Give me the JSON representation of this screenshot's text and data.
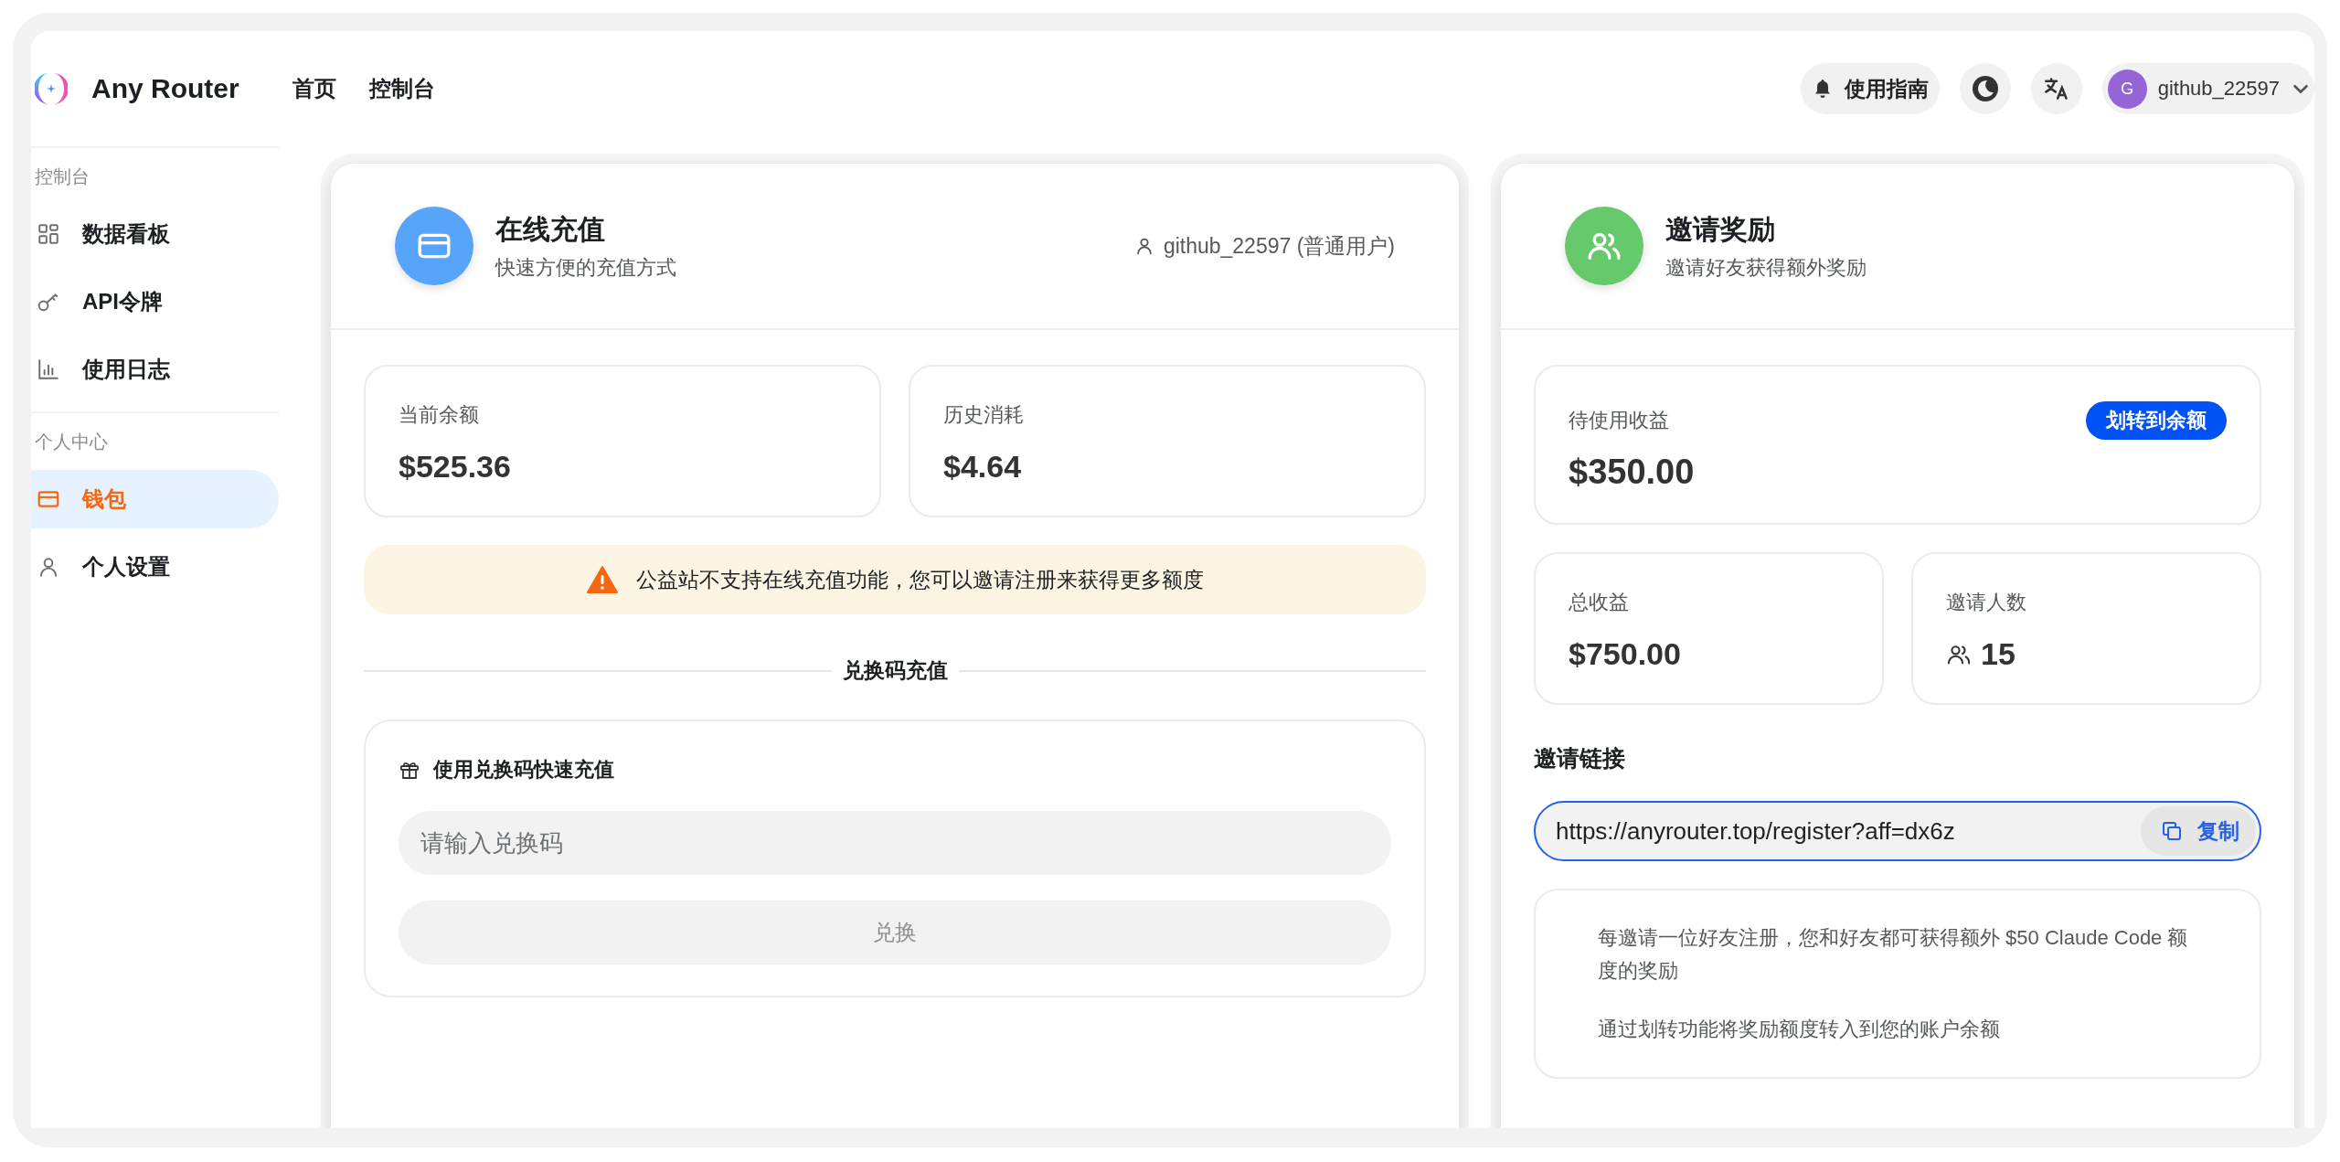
{
  "header": {
    "brand": "Any Router",
    "nav": [
      {
        "label": "首页"
      },
      {
        "label": "控制台"
      }
    ],
    "guide_button": "使用指南",
    "user": {
      "avatar_letter": "G",
      "name": "github_22597"
    }
  },
  "sidebar": {
    "sections": [
      {
        "title": "控制台",
        "items": [
          {
            "kind": "dashboard",
            "label": "数据看板",
            "selected": false
          },
          {
            "kind": "key",
            "label": "API令牌",
            "selected": false
          },
          {
            "kind": "chart",
            "label": "使用日志",
            "selected": false
          }
        ]
      },
      {
        "title": "个人中心",
        "items": [
          {
            "kind": "wallet",
            "label": "钱包",
            "selected": true
          },
          {
            "kind": "person",
            "label": "个人设置",
            "selected": false
          }
        ]
      }
    ]
  },
  "recharge_card": {
    "title": "在线充值",
    "subtitle": "快速方便的充值方式",
    "user_label": "github_22597 (普通用户)",
    "stats": [
      {
        "label": "当前余额",
        "value": "$525.36"
      },
      {
        "label": "历史消耗",
        "value": "$4.64"
      }
    ],
    "notice": "公益站不支持在线充值功能，您可以邀请注册来获得更多额度",
    "divider_title": "兑换码充值",
    "redeem": {
      "heading": "使用兑换码快速充值",
      "placeholder": "请输入兑换码",
      "button": "兑换",
      "button_disabled": true
    }
  },
  "invite_card": {
    "title": "邀请奖励",
    "subtitle": "邀请好友获得额外奖励",
    "pending": {
      "label": "待使用收益",
      "value": "$350.00",
      "button": "划转到余额"
    },
    "stats": [
      {
        "kind": "money",
        "label": "总收益",
        "value": "$750.00"
      },
      {
        "kind": "people",
        "label": "邀请人数",
        "value": "15"
      }
    ],
    "link_label": "邀请链接",
    "link": {
      "value": "https://anyrouter.top/register?aff=dx6z",
      "button": "复制",
      "focused": true
    },
    "info": [
      "每邀请一位好友注册，您和好友都可获得额外 $50 Claude Code 额度的奖励",
      "通过划转功能将奖励额度转入到您的账户余额"
    ]
  }
}
